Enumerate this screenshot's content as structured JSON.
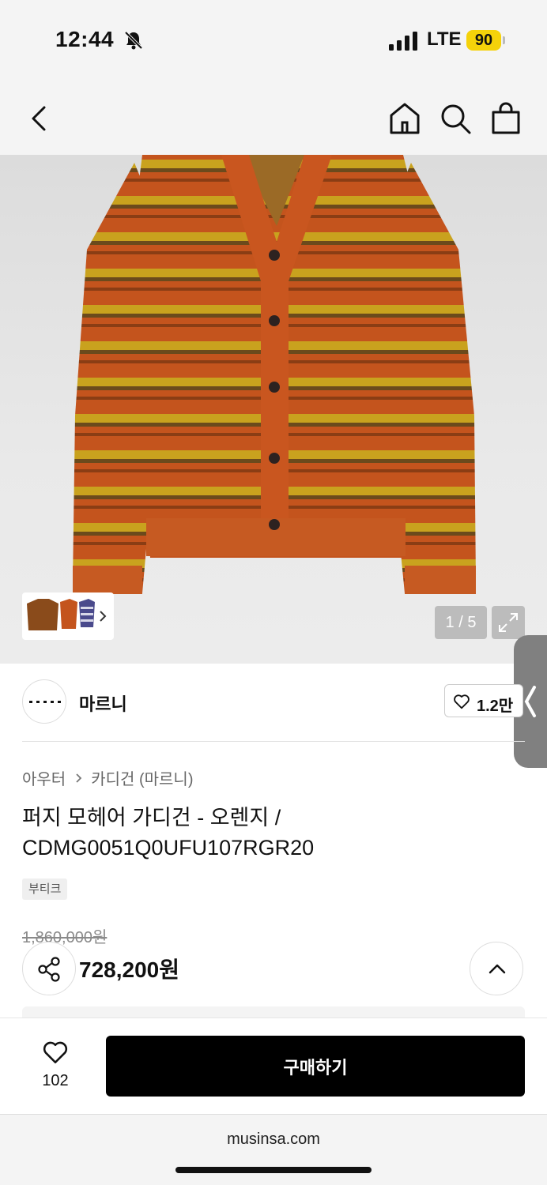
{
  "status_bar": {
    "time": "12:44",
    "network": "LTE",
    "battery": "90",
    "icons": [
      "bell-slash-icon",
      "signal-icon"
    ]
  },
  "nav": {
    "icons": [
      "back-icon",
      "home-icon",
      "search-icon",
      "shopping-bag-icon"
    ]
  },
  "gallery": {
    "counter": "1 / 5",
    "current_image": 1,
    "image_count": 5,
    "icons": [
      "chevron-right-icon",
      "expand-icon"
    ]
  },
  "brand": {
    "name": "마르니",
    "likes": "1.2만"
  },
  "product": {
    "breadcrumb": [
      "아우터",
      "카디건 (마르니)"
    ],
    "title": "퍼지 모헤어 가디건 - 오렌지 / CDMG0051Q0UFU107RGR20",
    "tag": "부티크",
    "original_price": "1,860,000원",
    "sale_price": "728,200원"
  },
  "actions": {
    "wish_count": "102",
    "buy_label": "구매하기"
  },
  "browser": {
    "url": "musinsa.com"
  },
  "colors": {
    "knit_orange": "#c4541d",
    "knit_yellow": "#c9a21e",
    "buy_button": "#000000",
    "battery": "#f5d20a"
  }
}
